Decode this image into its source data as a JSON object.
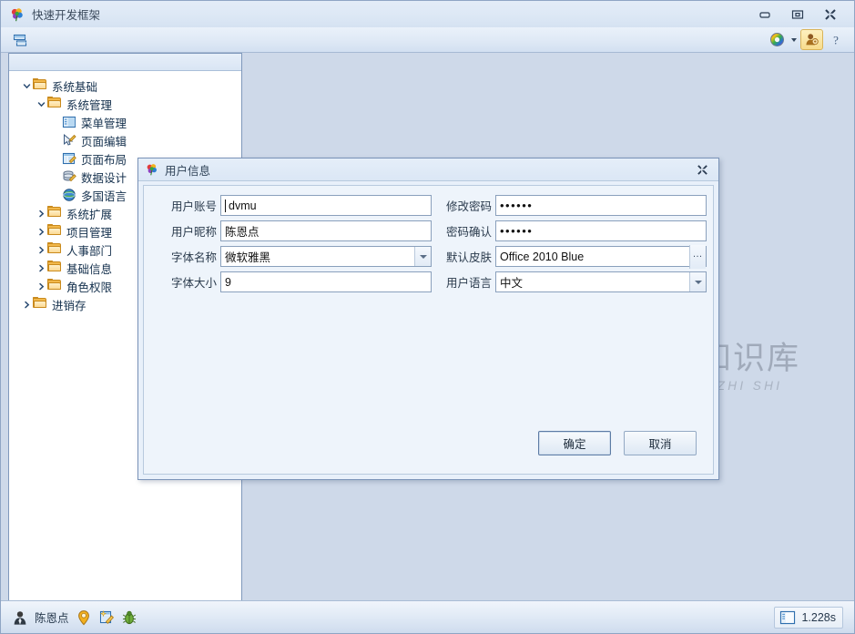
{
  "window": {
    "title": "快速开发框架",
    "icon": "flower-logo-icon",
    "controls": {
      "minimize": "minimize-icon",
      "restore": "restore-icon",
      "close": "close-icon"
    }
  },
  "toolbar": {
    "left_items": [
      {
        "name": "panel-layout-icon",
        "label": ""
      }
    ],
    "right_items": [
      {
        "name": "color-wheel-icon",
        "label": ""
      },
      {
        "name": "user-account-icon",
        "label": "",
        "active": true
      },
      {
        "name": "help-icon",
        "label": "?"
      }
    ]
  },
  "tree": {
    "items": [
      {
        "label": "系统基础",
        "icon": "folder-icon",
        "indent": 0,
        "expander": "chevron-down-icon"
      },
      {
        "label": "系统管理",
        "icon": "folder-icon",
        "indent": 1,
        "expander": "chevron-down-icon"
      },
      {
        "label": "菜单管理",
        "icon": "menu-manage-icon",
        "indent": 2,
        "expander": ""
      },
      {
        "label": "页面编辑",
        "icon": "page-edit-icon",
        "indent": 2,
        "expander": ""
      },
      {
        "label": "页面布局",
        "icon": "page-layout-icon",
        "indent": 2,
        "expander": ""
      },
      {
        "label": "数据设计",
        "icon": "database-design-icon",
        "indent": 2,
        "expander": ""
      },
      {
        "label": "多国语言",
        "icon": "globe-icon",
        "indent": 2,
        "expander": ""
      },
      {
        "label": "系统扩展",
        "icon": "folder-icon",
        "indent": 1,
        "expander": "chevron-right-icon"
      },
      {
        "label": "项目管理",
        "icon": "folder-icon",
        "indent": 1,
        "expander": "chevron-right-icon"
      },
      {
        "label": "人事部门",
        "icon": "folder-icon",
        "indent": 1,
        "expander": "chevron-right-icon"
      },
      {
        "label": "基础信息",
        "icon": "folder-icon",
        "indent": 1,
        "expander": "chevron-right-icon"
      },
      {
        "label": "角色权限",
        "icon": "folder-icon",
        "indent": 1,
        "expander": "chevron-right-icon"
      },
      {
        "label": "进销存",
        "icon": "folder-icon",
        "indent": 0,
        "expander": "chevron-right-icon"
      }
    ]
  },
  "watermark": {
    "logo": "ox-circle-logo-icon",
    "text_cn": "小牛知识库",
    "text_en": "XIAO NIU ZHI SHI KU"
  },
  "dialog": {
    "title": "用户信息",
    "icon": "flower-logo-icon",
    "close": "close-icon",
    "fields": {
      "account_label": "用户账号",
      "account_value": "dvmu",
      "password_label": "修改密码",
      "password_value": "••••••",
      "nickname_label": "用户昵称",
      "nickname_value": "陈恩点",
      "password_confirm_label": "密码确认",
      "password_confirm_value": "••••••",
      "font_name_label": "字体名称",
      "font_name_value": "微软雅黑",
      "skin_label": "默认皮肤",
      "skin_value": "Office 2010 Blue",
      "skin_button": "…",
      "font_size_label": "字体大小",
      "font_size_value": "9",
      "language_label": "用户语言",
      "language_value": "中文"
    },
    "buttons": {
      "ok": "确定",
      "cancel": "取消"
    }
  },
  "statusbar": {
    "user_icon": "user-avatar-icon",
    "user_name": "陈恩点",
    "icons": [
      "location-pin-icon",
      "wand-page-icon",
      "bug-icon"
    ],
    "timer_icon": "panel-icon",
    "timer_value": "1.228s"
  },
  "colors": {
    "window_bg": "#ced9e9",
    "accent": "#7a93b8",
    "folder": "#f2b84b",
    "title_text": "#3b4a5c"
  }
}
